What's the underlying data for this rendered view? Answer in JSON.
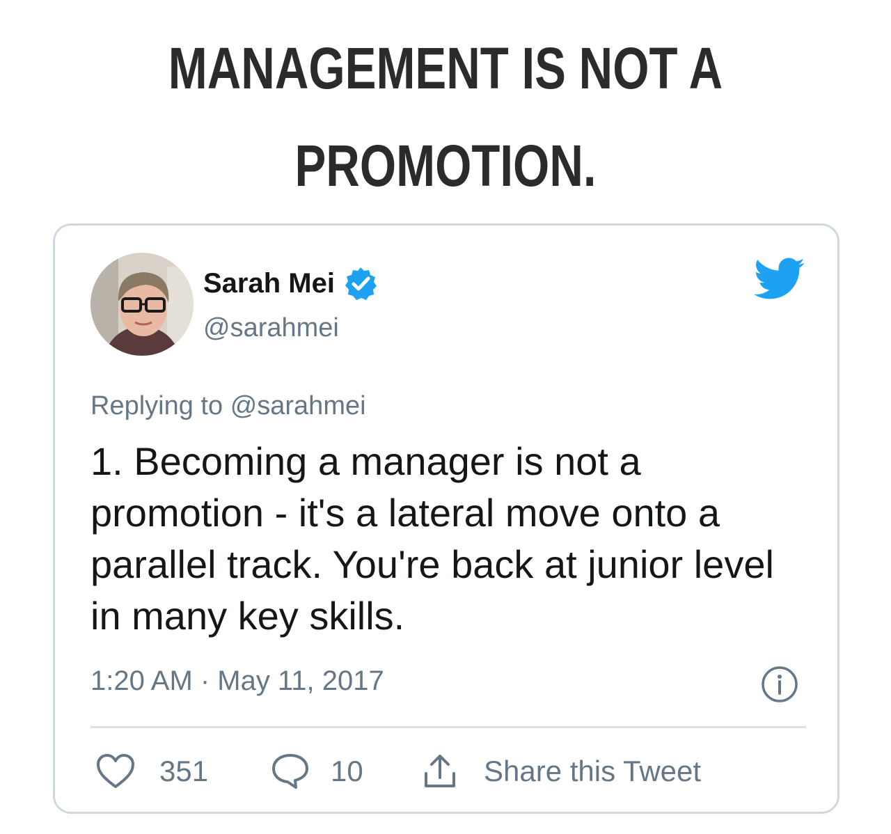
{
  "headline": {
    "line1": "MANAGEMENT IS NOT A",
    "line2": "PROMOTION."
  },
  "tweet": {
    "author": {
      "display_name": "Sarah Mei",
      "handle": "@sarahmei",
      "verified": true
    },
    "replying_prefix": "Replying to",
    "replying_handle": "@sarahmei",
    "text": "1. Becoming a manager is not a promotion - it's a lateral move onto a parallel track. You're back at junior level in many key skills.",
    "timestamp": "1:20 AM · May 11, 2017",
    "likes": "351",
    "replies": "10",
    "share_label": "Share this Tweet"
  },
  "icons": {
    "verified": "verified-badge-icon",
    "bird": "twitter-bird-icon",
    "info": "info-icon",
    "like": "heart-icon",
    "reply": "speech-bubble-icon",
    "share": "share-upload-icon"
  },
  "colors": {
    "twitter_blue": "#1da1f2",
    "secondary_text": "#657786",
    "primary_text": "#14171a",
    "card_border": "#cfd9de",
    "headline": "#2b2b2b"
  }
}
